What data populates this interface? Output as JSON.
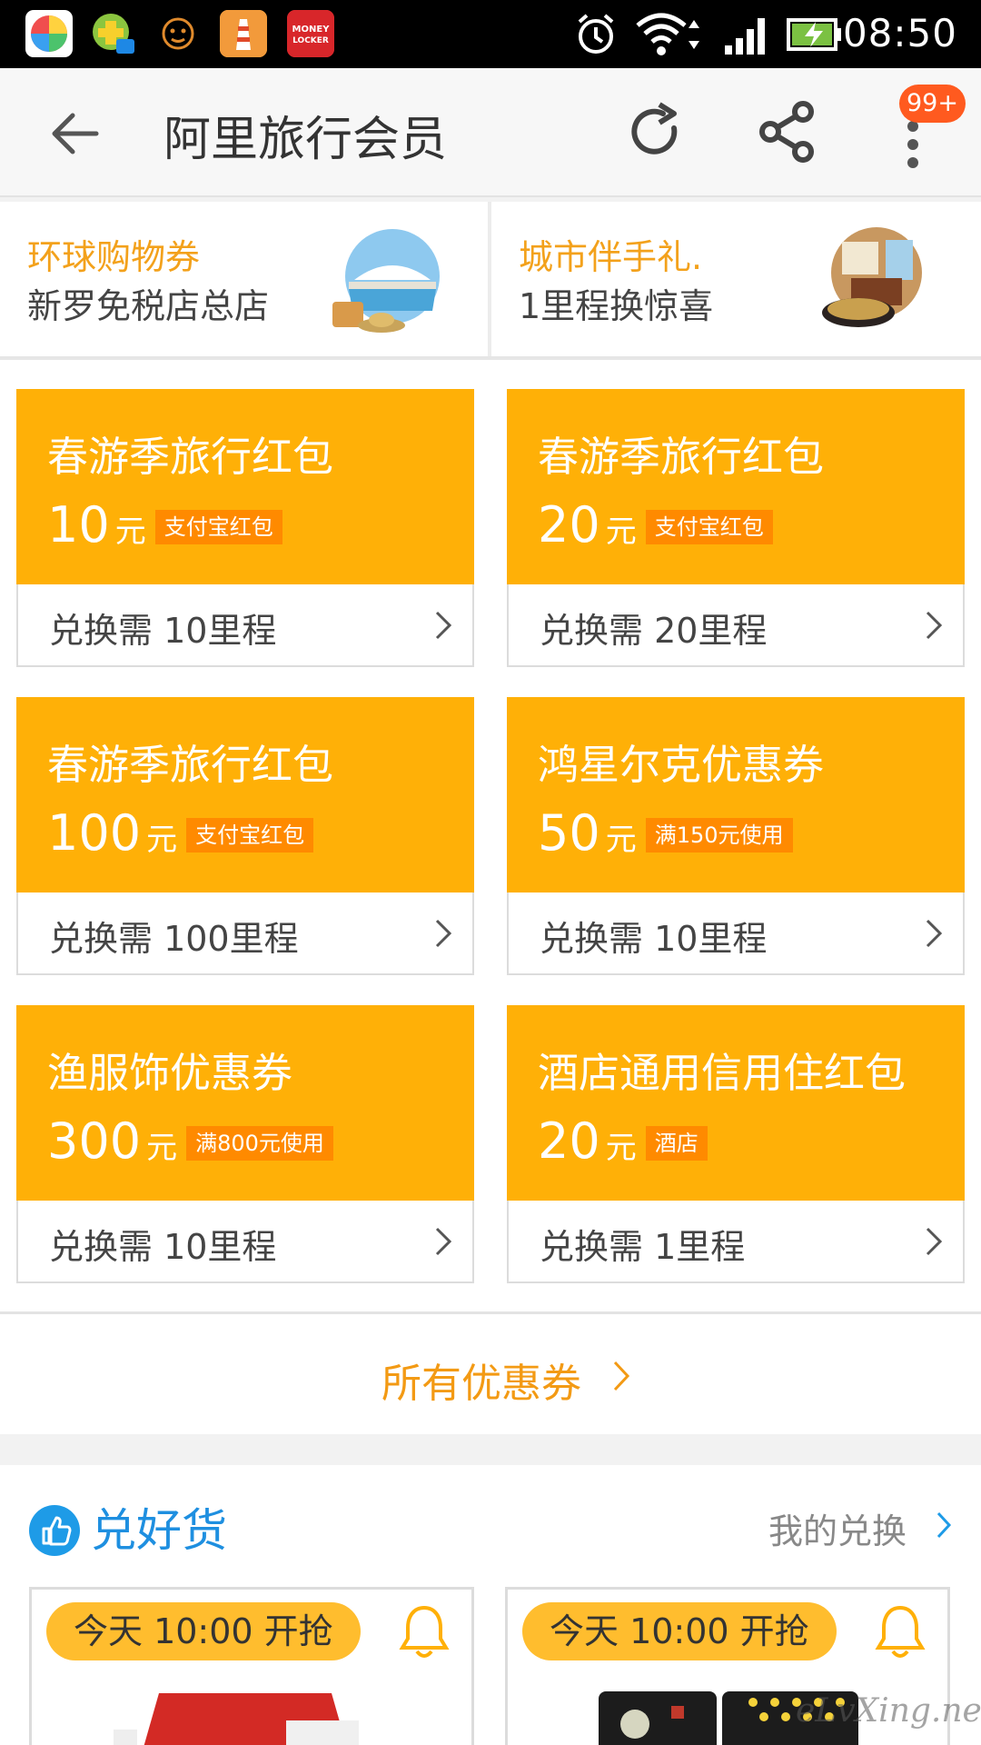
{
  "status_bar": {
    "time": "08:50",
    "app_icons": [
      "multicolor-app-icon",
      "green-plus-mail-icon",
      "smiley-face-icon",
      "lighthouse-app-icon",
      "money-locker-icon"
    ],
    "money_locker_text": "MONEY LOCKER"
  },
  "appbar": {
    "title": "阿里旅行会员",
    "badge": "99+"
  },
  "promos": [
    {
      "title": "环球购物券",
      "subtitle": "新罗免税店总店"
    },
    {
      "title": "城市伴手礼.",
      "subtitle": "1里程换惊喜"
    }
  ],
  "coupons": [
    {
      "title": "春游季旅行红包",
      "amount": "10",
      "unit": "元",
      "tag": "支付宝红包",
      "cost": "兑换需 10里程"
    },
    {
      "title": "春游季旅行红包",
      "amount": "20",
      "unit": "元",
      "tag": "支付宝红包",
      "cost": "兑换需 20里程"
    },
    {
      "title": "春游季旅行红包",
      "amount": "100",
      "unit": "元",
      "tag": "支付宝红包",
      "cost": "兑换需 100里程"
    },
    {
      "title": "鸿星尔克优惠券",
      "amount": "50",
      "unit": "元",
      "tag": "满150元使用",
      "cost": "兑换需 10里程"
    },
    {
      "title": "渔服饰优惠券",
      "amount": "300",
      "unit": "元",
      "tag": "满800元使用",
      "cost": "兑换需 10里程"
    },
    {
      "title": "酒店通用信用住红包",
      "amount": "20",
      "unit": "元",
      "tag": "酒店",
      "cost": "兑换需 1里程"
    }
  ],
  "all_coupons_label": "所有优惠券",
  "goods": {
    "title": "兑好货",
    "my_exchange": "我的兑换",
    "items": [
      {
        "start_label": "今天 10:00 开抢"
      },
      {
        "start_label": "今天 10:00 开抢"
      }
    ]
  },
  "watermark": "eLvXing.net",
  "colors": {
    "coupon_orange": "#ffb007",
    "tag_orange": "#ff8a00",
    "accent_blue": "#1e8fe0",
    "link_orange": "#f39a14"
  }
}
